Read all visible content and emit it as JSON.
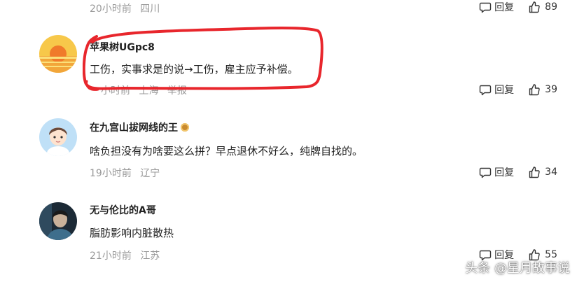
{
  "comments": [
    {
      "username": "",
      "content": "",
      "time": "20小时前",
      "location": "四川",
      "report": "",
      "reply_label": "回复",
      "likes": "89"
    },
    {
      "username": "苹果树UGpc8",
      "content": "工伤，实事求是的说→工伤，雇主应予补偿。",
      "time": "小时前",
      "location": "上海",
      "report": "举报",
      "reply_label": "回复",
      "likes": "39"
    },
    {
      "username": "在九宫山拔网线的王",
      "content": "啥负担没有为啥要这么拼？早点退休不好么，纯牌自找的。",
      "time": "19小时前",
      "location": "辽宁",
      "report": "",
      "reply_label": "回复",
      "likes": "34"
    },
    {
      "username": "无与伦比的A哥",
      "content": "脂肪影响内脏散热",
      "time": "21小时前",
      "location": "江苏",
      "report": "",
      "reply_label": "回复",
      "likes": "55"
    }
  ],
  "watermark": "头条 @星月故事说",
  "colors": {
    "meta_text": "#999999",
    "highlight_stroke": "#e8262c",
    "text": "#222222"
  },
  "icons": [
    "reply-icon",
    "thumbs-up-icon",
    "badge-icon"
  ]
}
